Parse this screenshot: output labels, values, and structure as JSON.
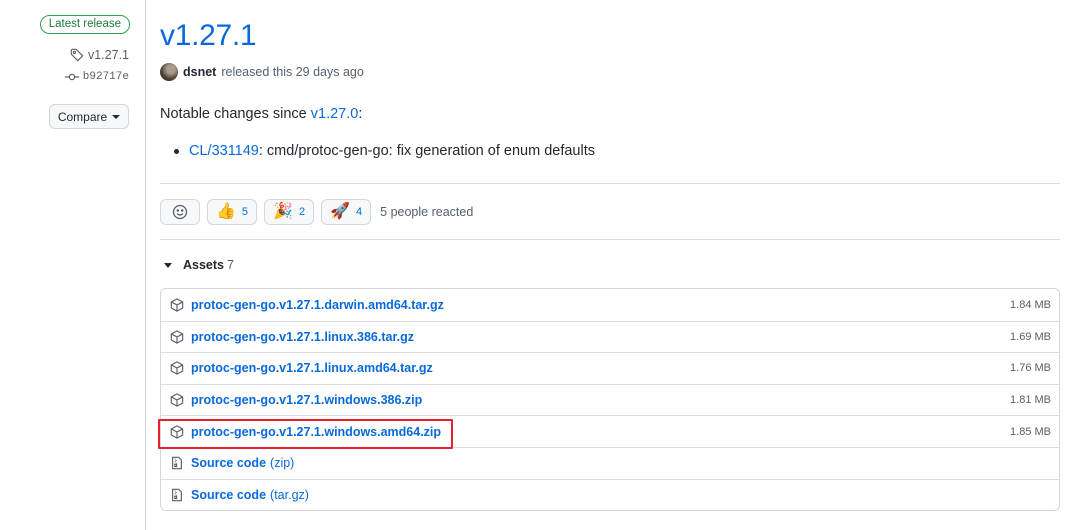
{
  "sidebar": {
    "badge": "Latest release",
    "tag": "v1.27.1",
    "commit": "b92717e",
    "compare_label": "Compare"
  },
  "release": {
    "title": "v1.27.1",
    "author": "dsnet",
    "released_text": "released this 29 days ago",
    "notable_prefix": "Notable changes since ",
    "notable_version": "v1.27.0",
    "notable_suffix": ":",
    "changes": [
      {
        "link": "CL/331149",
        "text": ": cmd/protoc-gen-go: fix generation of enum defaults"
      }
    ]
  },
  "reactions": {
    "items": [
      {
        "emoji": "👍",
        "count": "5"
      },
      {
        "emoji": "🎉",
        "count": "2"
      },
      {
        "emoji": "🚀",
        "count": "4"
      }
    ],
    "summary": "5 people reacted"
  },
  "assets": {
    "label": "Assets",
    "count": "7",
    "files": [
      {
        "name": "protoc-gen-go.v1.27.1.darwin.amd64.tar.gz",
        "size": "1.84 MB"
      },
      {
        "name": "protoc-gen-go.v1.27.1.linux.386.tar.gz",
        "size": "1.69 MB"
      },
      {
        "name": "protoc-gen-go.v1.27.1.linux.amd64.tar.gz",
        "size": "1.76 MB"
      },
      {
        "name": "protoc-gen-go.v1.27.1.windows.386.zip",
        "size": "1.81 MB"
      },
      {
        "name": "protoc-gen-go.v1.27.1.windows.amd64.zip",
        "size": "1.85 MB",
        "highlighted": true
      }
    ],
    "source": [
      {
        "label": "Source code",
        "suffix": "(zip)"
      },
      {
        "label": "Source code",
        "suffix": "(tar.gz)"
      }
    ]
  },
  "colors": {
    "link": "#0969da",
    "badge_green": "#1a7f37",
    "highlight": "#e5212b",
    "muted": "#57606a"
  }
}
